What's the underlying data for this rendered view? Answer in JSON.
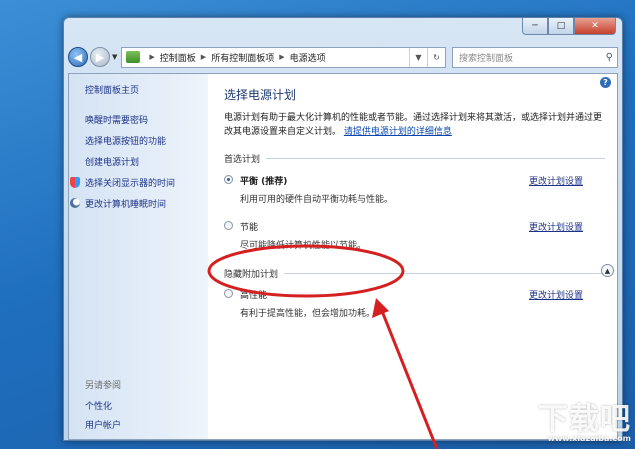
{
  "window": {
    "caption_buttons": {
      "minimize": "─",
      "maximize": "□",
      "close": "✕"
    }
  },
  "address": {
    "breadcrumb": [
      "控制面板",
      "所有控制面板项",
      "电源选项"
    ],
    "refresh_icon": "refresh-icon",
    "search_placeholder": "搜索控制面板"
  },
  "sidebar": {
    "home": "控制面板主页",
    "items": [
      "唤醒时需要密码",
      "选择电源按钮的功能",
      "创建电源计划",
      "选择关闭显示器的时间",
      "更改计算机睡眠时间"
    ],
    "see_also_heading": "另请参阅",
    "see_also": [
      "个性化",
      "用户帐户"
    ]
  },
  "main": {
    "title": "选择电源计划",
    "description": "电源计划有助于最大化计算机的性能或者节能。通过选择计划来将其激活，或选择计划并通过更改其电源设置来自定义计划。",
    "description_link": "请提供电源计划的详细信息",
    "preferred_heading": "首选计划",
    "hidden_heading": "隐藏附加计划",
    "change_link": "更改计划设置",
    "plans": [
      {
        "name": "平衡 (推荐)",
        "desc": "利用可用的硬件自动平衡功耗与性能。",
        "selected": true
      },
      {
        "name": "节能",
        "desc": "尽可能降低计算机性能以节能。",
        "selected": false
      },
      {
        "name": "高性能",
        "desc": "有利于提高性能，但会增加功耗。",
        "selected": false
      }
    ]
  },
  "watermark": {
    "text": "下载吧",
    "url": "www.xiazaiba.com"
  },
  "annotation_color": "#d42020"
}
